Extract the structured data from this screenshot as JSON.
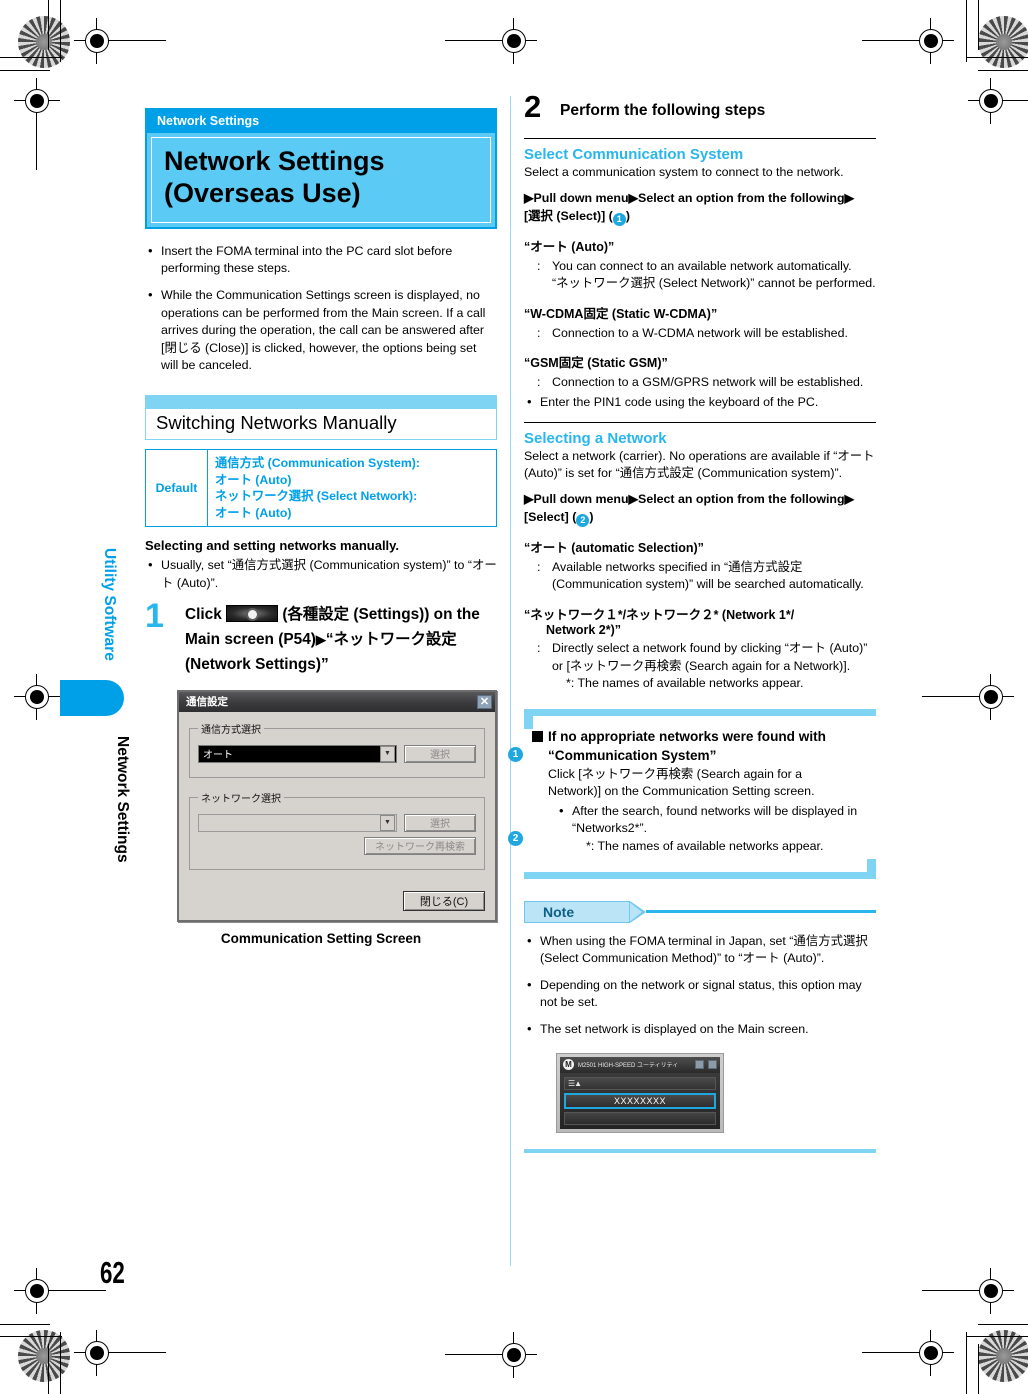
{
  "meta": {
    "page_number": "62",
    "accent_blue": "#00A0E9",
    "light_blue": "#7FD4F3",
    "header_blue": "#5BCBF5"
  },
  "sidetab": {
    "upper_label": "Utility Software",
    "lower_label": "Network Settings"
  },
  "left": {
    "chapter": {
      "eyebrow": "Network Settings",
      "title_line1": "Network Settings",
      "title_line2": "(Overseas Use)"
    },
    "intro_bullets": [
      "Insert the FOMA terminal into the PC card slot before performing these steps.",
      "While the Communication Settings screen is displayed, no operations can be performed from the Main screen. If a call arrives during the operation, the call can be answered after [閉じる (Close)] is clicked, however, the options being set will be canceled."
    ],
    "section_header": "Switching Networks Manually",
    "default_table": {
      "key": "Default",
      "lines": [
        "通信方式 (Communication System):",
        "オート (Auto)",
        "ネットワーク選択 (Select Network):",
        "オート (Auto)"
      ]
    },
    "lead": "Selecting and setting networks manually.",
    "lead_bullets": [
      "Usually, set “通信方式選択 (Communication system)” to “オート (Auto)”."
    ],
    "step1": {
      "number": "1",
      "text_before_icon": "Click",
      "text_after_icon": " (各種設定 (Settings)) on the Main screen (P54)",
      "arrow": "▶",
      "text_tail": "“ネットワーク設定 (Network Settings)”"
    },
    "dialog": {
      "title": "通信設定",
      "close_icon": "✕",
      "group1_legend": "通信方式選択",
      "group1_combo_value": "オート",
      "group1_button": "選択",
      "group1_callout": "1",
      "group2_legend": "ネットワーク選択",
      "group2_combo_value": "",
      "group2_button": "選択",
      "group2_button2": "ネットワーク再検索",
      "group2_callout": "2",
      "close_button": "閉じる(C)"
    },
    "dialog_caption": "Communication Setting Screen"
  },
  "right": {
    "step2": {
      "number": "2",
      "title": "Perform the following steps"
    },
    "sec1": {
      "heading": "Select Communication System",
      "intro": "Select a communication system to connect to the network.",
      "path_prefix": "▶Pull down menu▶Select an option from the following▶",
      "path_suffix": "[選択 (Select)] (",
      "path_callout": "1",
      "path_close": ")",
      "terms": [
        {
          "term": "“オート (Auto)”",
          "def_line1": "You can connect to an available network automatically.",
          "def_line2": "“ネットワーク選択 (Select Network)” cannot be performed."
        },
        {
          "term": "“W-CDMA固定 (Static W-CDMA)”",
          "def_line1": "Connection to a W-CDMA network will be established.",
          "def_line2": ""
        },
        {
          "term": "“GSM固定 (Static GSM)”",
          "def_line1": "Connection to a GSM/GPRS network will be established.",
          "def_line2": ""
        }
      ],
      "bullet": "Enter the PIN1 code using the keyboard of the PC."
    },
    "sec2": {
      "heading": "Selecting a Network",
      "intro": "Select a network (carrier). No operations are available if “オート (Auto)” is set for “通信方式設定 (Communication system)”.",
      "path_prefix": "▶Pull down menu▶Select an option from the following▶",
      "path_suffix": "[Select] (",
      "path_callout": "2",
      "path_close": ")",
      "term1": "“オート (automatic Selection)”",
      "term1_def_l1": "Available networks specified in “通信方式設定",
      "term1_def_l2": "(Communication system)” will be searched automatically.",
      "term2_l1": "“ネットワーク１*/ネットワーク２* (Network 1*/",
      "term2_l2": "Network 2*)”",
      "term2_def_l1": "Directly select a network found by clicking “オート (Auto)”",
      "term2_def_l2": "or [ネットワーク再検索 (Search again for a Network)].",
      "term2_def_l3": "*:  The names of available networks appear."
    },
    "infobox": {
      "title_l1": "If no appropriate networks were found with",
      "title_l2": "“Communication System”",
      "body_l1": "Click [ネットワーク再検索 (Search again for a",
      "body_l2": "Network)] on the Communication Setting screen.",
      "bullet_l1": "After the search, found networks will be displayed in",
      "bullet_l2": "“Networks2*”.",
      "sub_note": "*:  The names of available networks appear."
    },
    "note": {
      "tag": "Note",
      "items": [
        "When using the FOMA terminal in Japan, set “通信方式選択 (Select Communication Method)” to “オート (Auto)”.",
        "Depending on the network or signal status, this option may not be set.",
        "The set network is displayed on the Main screen."
      ]
    },
    "mini_screen": {
      "title": "M2501 HIGH-SPEED ユーティリティ",
      "logo": "M",
      "antenna_icon": "signal-icon",
      "network_value": "XXXXXXXX"
    }
  }
}
